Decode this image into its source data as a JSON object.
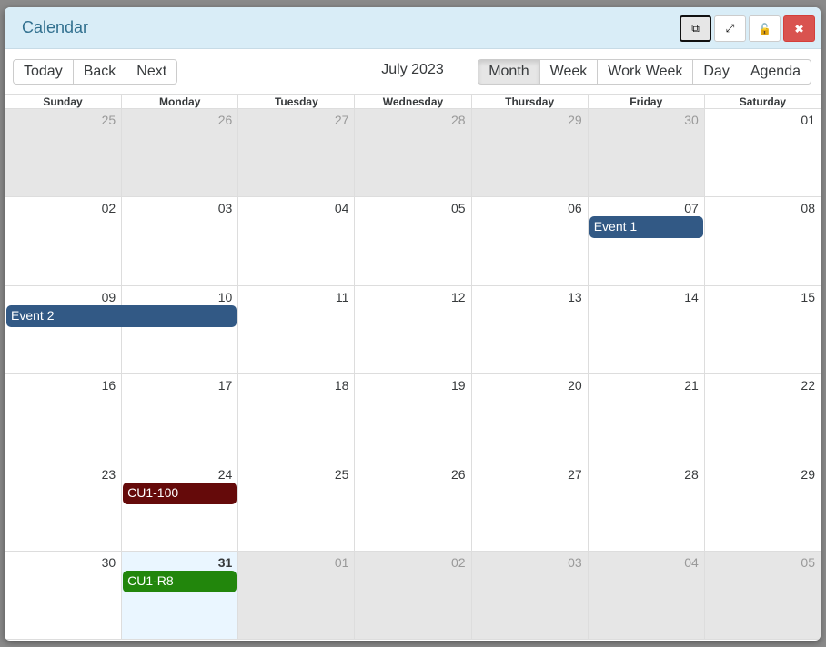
{
  "header": {
    "title": "Calendar",
    "buttons": [
      {
        "name": "copy-icon",
        "glyph": "⧉"
      },
      {
        "name": "expand-icon",
        "glyph": "⤢"
      },
      {
        "name": "unlock-icon",
        "glyph": "🔓"
      },
      {
        "name": "close-icon",
        "glyph": "✖"
      }
    ]
  },
  "toolbar": {
    "nav": [
      "Today",
      "Back",
      "Next"
    ],
    "label": "July 2023",
    "views": [
      "Month",
      "Week",
      "Work Week",
      "Day",
      "Agenda"
    ],
    "active_view": "Month"
  },
  "weekdays": [
    "Sunday",
    "Monday",
    "Tuesday",
    "Wednesday",
    "Thursday",
    "Friday",
    "Saturday"
  ],
  "weeks": [
    {
      "days": [
        "25",
        "26",
        "27",
        "28",
        "29",
        "30",
        "01"
      ],
      "off": [
        0,
        1,
        2,
        3,
        4,
        5
      ]
    },
    {
      "days": [
        "02",
        "03",
        "04",
        "05",
        "06",
        "07",
        "08"
      ],
      "off": []
    },
    {
      "days": [
        "09",
        "10",
        "11",
        "12",
        "13",
        "14",
        "15"
      ],
      "off": []
    },
    {
      "days": [
        "16",
        "17",
        "18",
        "19",
        "20",
        "21",
        "22"
      ],
      "off": []
    },
    {
      "days": [
        "23",
        "24",
        "25",
        "26",
        "27",
        "28",
        "29"
      ],
      "off": []
    },
    {
      "days": [
        "30",
        "31",
        "01",
        "02",
        "03",
        "04",
        "05"
      ],
      "off": [
        2,
        3,
        4,
        5,
        6
      ],
      "today": 1
    }
  ],
  "events": [
    {
      "title": "Event 1",
      "week": 1,
      "start": 5,
      "span": 1,
      "color": "#325985"
    },
    {
      "title": "Event 2",
      "week": 2,
      "start": 0,
      "span": 2,
      "color": "#325985"
    },
    {
      "title": "CU1-100",
      "week": 4,
      "start": 1,
      "span": 1,
      "color": "#650a0a"
    },
    {
      "title": "CU1-R8",
      "week": 5,
      "start": 1,
      "span": 1,
      "color": "#22860c"
    }
  ]
}
